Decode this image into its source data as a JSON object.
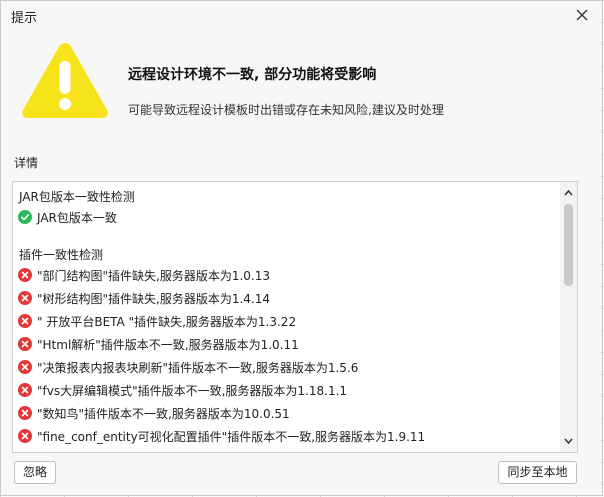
{
  "dialog": {
    "title": "提示",
    "headline": "远程设计环境不一致, 部分功能将受影响",
    "subline": "可能导致远程设计模板时出错或存在未知风险,建议及时处理",
    "details_label": "详情"
  },
  "details": {
    "jar_section": "JAR包版本一致性检测",
    "jar_result": "JAR包版本一致",
    "plugin_section": "插件一致性检测",
    "plugin_items": [
      "\"部门结构图\"插件缺失,服务器版本为1.0.13",
      "\"树形结构图\"插件缺失,服务器版本为1.4.14",
      "\" 开放平台BETA \"插件缺失,服务器版本为1.3.22",
      "\"Html解析\"插件版本不一致,服务器版本为1.0.11",
      "\"决策报表内报表块刷新\"插件版本不一致,服务器版本为1.5.6",
      "\"fvs大屏编辑模式\"插件版本不一致,服务器版本为1.18.1.1",
      "\"数知鸟\"插件版本不一致,服务器版本为10.0.51",
      "\"fine_conf_entity可视化配置插件\"插件版本不一致,服务器版本为1.9.11"
    ]
  },
  "buttons": {
    "ignore": "忽略",
    "sync": "同步至本地"
  },
  "icons": {
    "warning": "warning-triangle-icon",
    "ok": "check-circle-icon",
    "error": "error-circle-icon",
    "close": "close-icon"
  },
  "colors": {
    "warning_yellow": "#f7e31a",
    "ok_green": "#2eb85c",
    "error_red": "#e4373a"
  }
}
